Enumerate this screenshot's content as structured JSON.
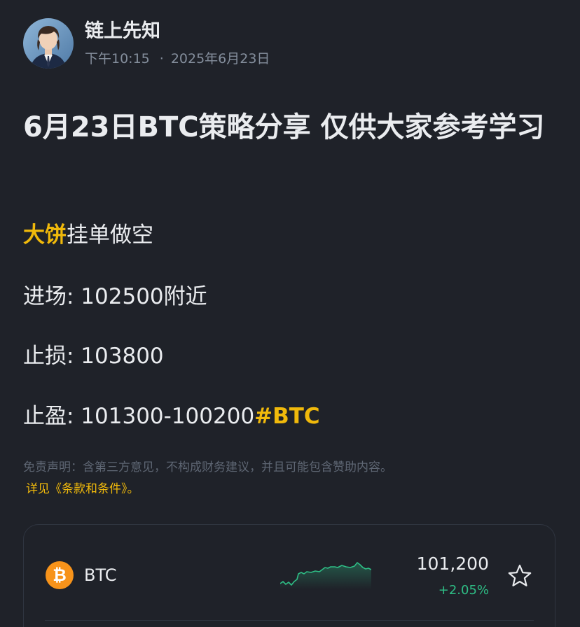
{
  "author": {
    "name": "链上先知",
    "time": "下午10:15",
    "separator": "·",
    "date": "2025年6月23日"
  },
  "post": {
    "title": "6月23日BTC策略分享 仅供大家参考学习",
    "line1_highlight": "大饼",
    "line1_rest": "挂单做空",
    "entry": "进场: 102500附近",
    "stop_loss": "止损: 103800",
    "take_profit": "止盈:  101300-100200",
    "hashtag": "#BTC"
  },
  "disclaimer": {
    "text": "免责声明：含第三方意见，不构成财务建议，并且可能包含赞助内容。",
    "link": "详见《条款和条件》。"
  },
  "coin_card": {
    "symbol": "BTC",
    "price": "101,200",
    "change": "+2.05%",
    "icon": "bitcoin-icon",
    "colors": {
      "icon_bg": "#f7931a",
      "change": "#2ebd85",
      "highlight": "#f0b90b"
    }
  }
}
